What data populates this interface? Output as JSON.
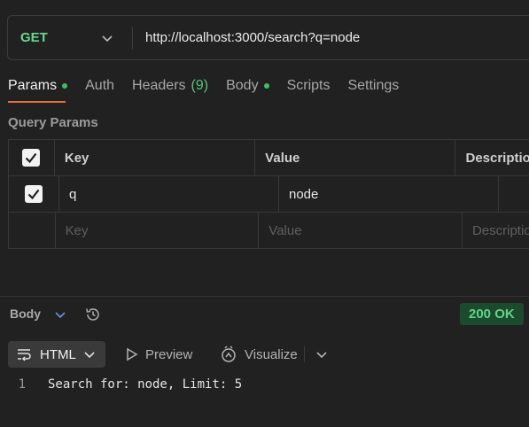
{
  "request": {
    "method": "GET",
    "url": "http://localhost:3000/search?q=node"
  },
  "tabs": [
    {
      "label": "Params",
      "dot": true,
      "active": true
    },
    {
      "label": "Auth"
    },
    {
      "label": "Headers",
      "count": "(9)"
    },
    {
      "label": "Body",
      "dot": true
    },
    {
      "label": "Scripts"
    },
    {
      "label": "Settings"
    }
  ],
  "query_params": {
    "title": "Query Params",
    "headers": {
      "key": "Key",
      "value": "Value",
      "description": "Description"
    },
    "rows": [
      {
        "checked": true,
        "key": "q",
        "value": "node",
        "description": ""
      }
    ],
    "placeholders": {
      "key": "Key",
      "value": "Value",
      "description": "Description"
    }
  },
  "response": {
    "label": "Body",
    "status": "200 OK",
    "format": "HTML",
    "preview_label": "Preview",
    "visualize_label": "Visualize",
    "lines": [
      {
        "number": "1",
        "text": "Search for: node, Limit: 5"
      }
    ]
  },
  "colors": {
    "accent_underline": "#ea6a3b",
    "method_get": "#6bd88f",
    "status_ok_bg": "#1b4a2c"
  }
}
